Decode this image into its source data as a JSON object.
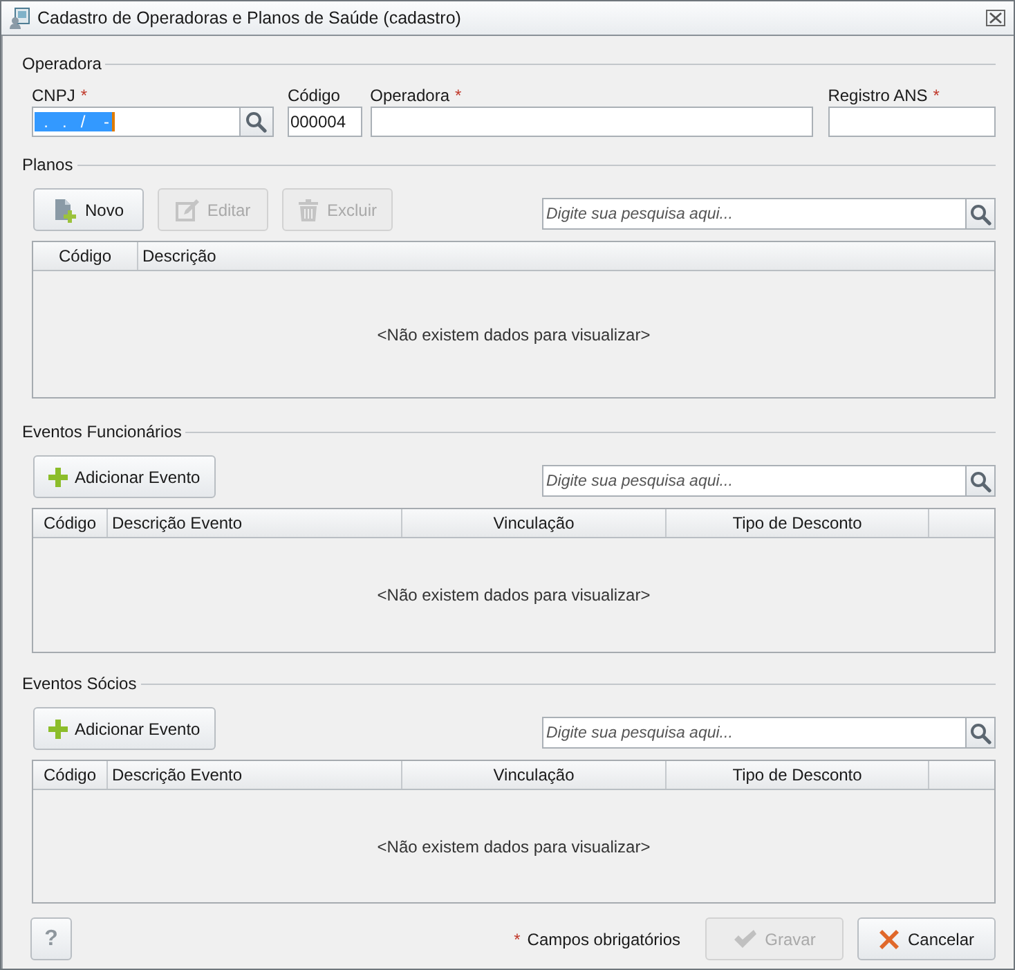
{
  "window": {
    "title": "Cadastro de Operadoras e Planos de Saúde (cadastro)"
  },
  "operadora": {
    "title": "Operadora",
    "fields": [
      {
        "kind": "lookup",
        "label": "CNPJ",
        "marker": "*",
        "value": "  .   .   /    -",
        "selected": true
      },
      {
        "kind": "text",
        "label": "Código",
        "value": "000004"
      },
      {
        "kind": "text",
        "label": "Operadora",
        "marker": "*"
      },
      {
        "kind": "text",
        "label": "Registro ANS",
        "marker": "*"
      }
    ]
  },
  "sections": [
    {
      "title": "Planos",
      "buttons": [
        {
          "kind": "new",
          "label": "Novo",
          "disabled": false
        },
        {
          "kind": "edit",
          "label": "Editar",
          "disabled": true
        },
        {
          "kind": "delete",
          "label": "Excluir",
          "disabled": true
        }
      ],
      "search": {
        "placeholder": "Digite sua pesquisa aqui..."
      },
      "table": {
        "columns": [
          "Código",
          "Descrição"
        ],
        "empty_message": "<Não existem dados para visualizar>"
      }
    },
    {
      "title": "Eventos Funcionários",
      "buttons": [
        {
          "kind": "add",
          "label": "Adicionar Evento",
          "disabled": false
        }
      ],
      "search": {
        "placeholder": "Digite sua pesquisa aqui..."
      },
      "table": {
        "columns": [
          "Código",
          "Descrição Evento",
          "Vinculação",
          "Tipo de Desconto"
        ],
        "empty_message": "<Não existem dados para visualizar>"
      }
    },
    {
      "title": "Eventos Sócios",
      "buttons": [
        {
          "kind": "add",
          "label": "Adicionar Evento",
          "disabled": false
        }
      ],
      "search": {
        "placeholder": "Digite sua pesquisa aqui..."
      },
      "table": {
        "columns": [
          "Código",
          "Descrição Evento",
          "Vinculação",
          "Tipo de Desconto"
        ],
        "empty_message": "<Não existem dados para visualizar>"
      }
    }
  ],
  "footer": {
    "help": "?",
    "required_note": {
      "mark": "*",
      "text": "Campos obrigatórios"
    },
    "buttons": [
      {
        "kind": "save",
        "label": "Gravar",
        "disabled": true
      },
      {
        "kind": "cancel",
        "label": "Cancelar",
        "disabled": false
      }
    ]
  }
}
